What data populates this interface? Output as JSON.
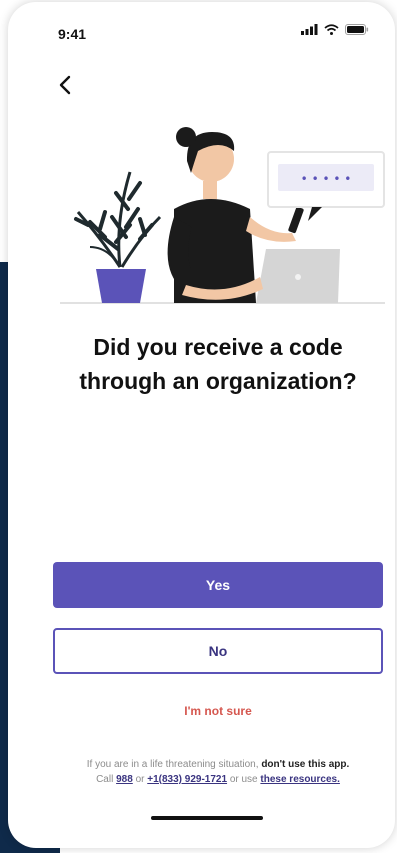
{
  "status_bar": {
    "time": "9:41",
    "icons": [
      "signal-icon",
      "wifi-icon",
      "battery-icon"
    ]
  },
  "nav": {
    "back_icon": "chevron-left-icon"
  },
  "illustration": {
    "name": "woman-with-phone-and-laptop",
    "password_dots": "• • • • •"
  },
  "question": {
    "line1": "Did you receive a code",
    "line2": "through an organization?"
  },
  "buttons": {
    "yes_label": "Yes",
    "no_label": "No",
    "not_sure_label": "I'm not sure"
  },
  "footer": {
    "line1_prefix": "If you are in a life threatening situation,",
    "line1_bold": "don't use this app.",
    "call_prefix": "Call",
    "number1": "988",
    "or_text": "or",
    "number2": "+1(833) 929-1721",
    "or_use_text": "or use",
    "resources_link": "these resources."
  },
  "colors": {
    "primary": "#5b53b8",
    "warning": "#d5574f",
    "backdrop": "#0f2a4a"
  }
}
